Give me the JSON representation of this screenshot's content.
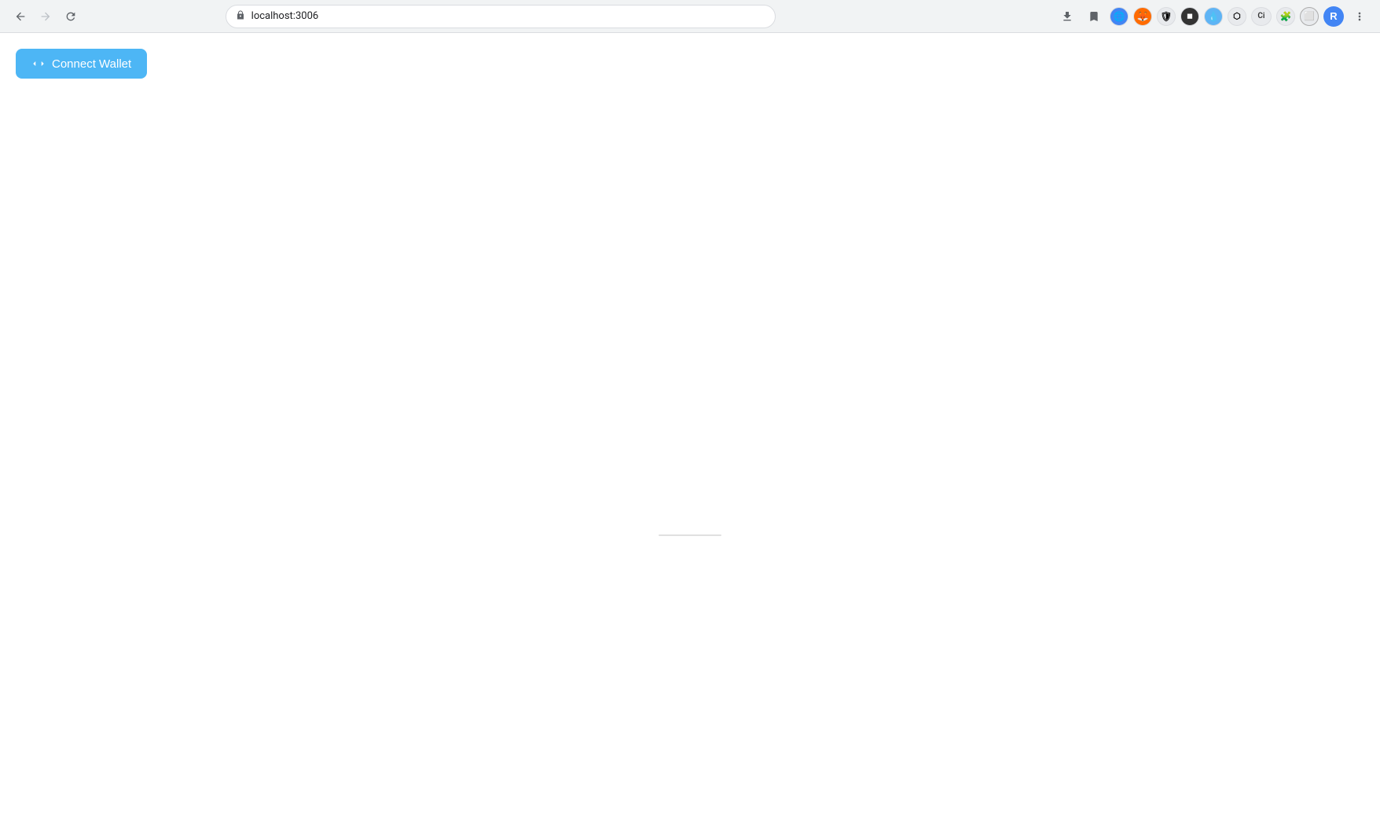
{
  "browser": {
    "url": "localhost:3006",
    "back_disabled": false,
    "forward_disabled": true,
    "reload_icon": "↻",
    "back_icon": "←",
    "forward_icon": "→",
    "download_icon": "⬇",
    "star_icon": "☆",
    "profile_label": "R",
    "menu_icon": "⋮"
  },
  "extensions": [
    {
      "id": "ext-1",
      "label": "🌐",
      "bg": "#4285f4",
      "color": "#fff"
    },
    {
      "id": "ext-2",
      "label": "🦊",
      "bg": "#ff6611",
      "color": "#fff"
    },
    {
      "id": "ext-3",
      "label": "🛡",
      "bg": "#e8eaed",
      "color": "#333"
    },
    {
      "id": "ext-4",
      "label": "◼",
      "bg": "#e8eaed",
      "color": "#333"
    },
    {
      "id": "ext-5",
      "label": "💧",
      "bg": "#e8f4fd",
      "color": "#333"
    },
    {
      "id": "ext-6",
      "label": "⬡",
      "bg": "#e8eaed",
      "color": "#333"
    },
    {
      "id": "ext-ci",
      "label": "Ci",
      "bg": "#e8eaed",
      "color": "#333"
    },
    {
      "id": "ext-puzzle",
      "label": "🧩",
      "bg": "#e8eaed",
      "color": "#333"
    },
    {
      "id": "ext-window",
      "label": "⬜",
      "bg": "#e8eaed",
      "color": "#333"
    }
  ],
  "page": {
    "connect_wallet_button_label": "Connect Wallet",
    "wallet_icon": "⇄"
  }
}
